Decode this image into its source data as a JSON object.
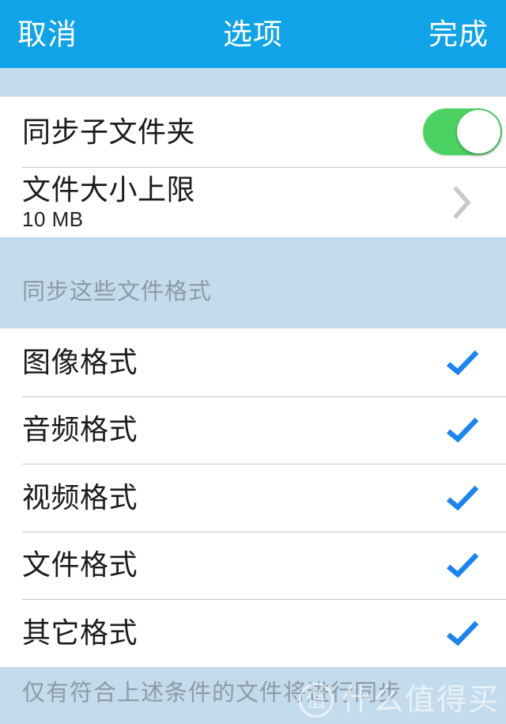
{
  "navbar": {
    "cancel_label": "取消",
    "title": "选项",
    "done_label": "完成",
    "background_color": "#10a3e8",
    "text_color": "#ffffff"
  },
  "colors": {
    "group_background": "#c3dced",
    "card_background": "#ffffff",
    "separator": "#c8c7cc",
    "switch_on": "#4bd263",
    "checkmark_blue": "#1a85f0",
    "chevron_gray": "#c9c9cd",
    "secondary_text": "#8e9aa3"
  },
  "section_one": {
    "rows": [
      {
        "title": "同步子文件夹",
        "accessory": "switch",
        "switch_state": "on"
      },
      {
        "title": "文件大小上限",
        "subtitle": "10 MB",
        "accessory": "chevron-right"
      }
    ]
  },
  "section_two": {
    "header": "同步这些文件格式",
    "footer": "仅有符合上述条件的文件将进行同步",
    "rows": [
      {
        "title": "图像格式",
        "accessory": "check",
        "checked": true
      },
      {
        "title": "音频格式",
        "accessory": "check",
        "checked": true
      },
      {
        "title": "视频格式",
        "accessory": "check",
        "checked": true
      },
      {
        "title": "文件格式",
        "accessory": "check",
        "checked": true
      },
      {
        "title": "其它格式",
        "accessory": "check",
        "checked": true
      }
    ]
  },
  "watermark": {
    "badge": "值",
    "text": "什么值得买"
  }
}
